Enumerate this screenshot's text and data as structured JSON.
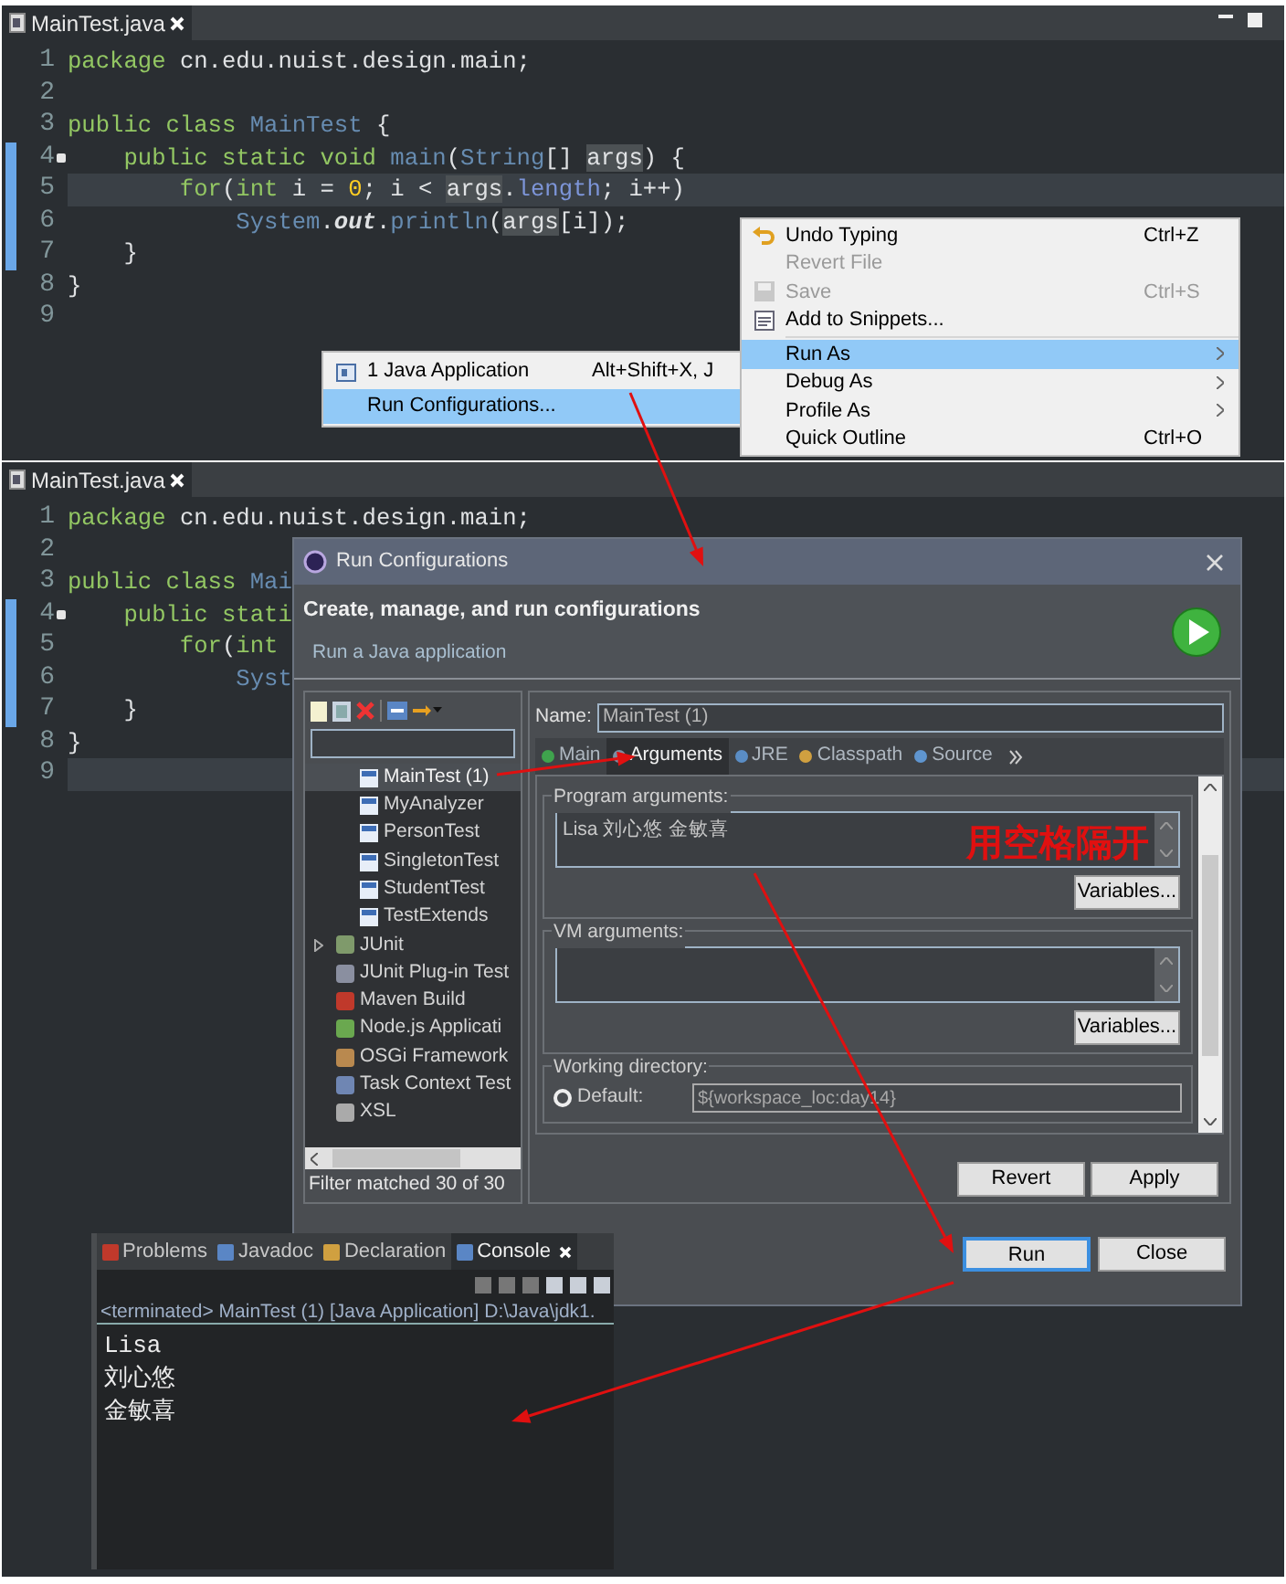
{
  "editors": [
    {
      "tab": {
        "label": "MainTest.java",
        "selected": true
      },
      "lines": [
        {
          "number": "1",
          "current": false,
          "changed": false,
          "override": false,
          "segments": [
            {
              "text": "package",
              "kind": "keyword"
            },
            {
              "text": " cn.edu.nuist.design.main;",
              "kind": "plain"
            }
          ]
        },
        {
          "number": "2",
          "current": false,
          "changed": false,
          "override": false
        },
        {
          "number": "3",
          "current": false,
          "changed": false,
          "override": false,
          "segments": [
            {
              "text": "public class ",
              "kind": "keyword"
            },
            {
              "text": "MainTest",
              "kind": "type"
            },
            {
              "text": " {",
              "kind": "plain"
            }
          ]
        },
        {
          "number": "4",
          "current": false,
          "changed": true,
          "override": true,
          "segments": [
            {
              "text": "    public static void ",
              "kind": "keyword"
            },
            {
              "text": "main",
              "kind": "method"
            },
            {
              "text": "(",
              "kind": "plain"
            },
            {
              "text": "String",
              "kind": "type"
            },
            {
              "text": "[] ",
              "kind": "plain"
            },
            {
              "text": "args",
              "kind": "occurrence"
            },
            {
              "text": ") {",
              "kind": "plain"
            }
          ]
        },
        {
          "number": "5",
          "current": true,
          "changed": true,
          "override": false,
          "segments": [
            {
              "text": "        for",
              "kind": "keyword"
            },
            {
              "text": "(",
              "kind": "plain"
            },
            {
              "text": "int",
              "kind": "keyword"
            },
            {
              "text": " i = ",
              "kind": "plain"
            },
            {
              "text": "0",
              "kind": "number"
            },
            {
              "text": "; i < ",
              "kind": "plain"
            },
            {
              "text": "args",
              "kind": "occurrence"
            },
            {
              "text": ".",
              "kind": "plain"
            },
            {
              "text": "length",
              "kind": "field"
            },
            {
              "text": "; i++)",
              "kind": "plain"
            }
          ]
        },
        {
          "number": "6",
          "current": false,
          "changed": true,
          "override": false,
          "segments": [
            {
              "text": "            System",
              "kind": "type"
            },
            {
              "text": ".",
              "kind": "plain"
            },
            {
              "text": "out",
              "kind": "static"
            },
            {
              "text": ".",
              "kind": "plain"
            },
            {
              "text": "println",
              "kind": "method"
            },
            {
              "text": "(",
              "kind": "plain"
            },
            {
              "text": "args",
              "kind": "occurrence"
            },
            {
              "text": "[i]);",
              "kind": "plain"
            }
          ]
        },
        {
          "number": "7",
          "current": false,
          "changed": true,
          "override": false,
          "segments": [
            {
              "text": "    }",
              "kind": "plain"
            }
          ]
        },
        {
          "number": "8",
          "current": false,
          "changed": false,
          "override": false,
          "segments": [
            {
              "text": "}",
              "kind": "plain"
            }
          ]
        },
        {
          "number": "9",
          "current": false,
          "changed": false,
          "override": false
        }
      ]
    },
    {
      "tab": {
        "label": "MainTest.java",
        "selected": true
      },
      "lines": [
        {
          "number": "1",
          "current": false,
          "changed": false,
          "override": false,
          "segments": [
            {
              "text": "package",
              "kind": "keyword"
            },
            {
              "text": " cn.edu.nuist.design.main;",
              "kind": "plain"
            }
          ]
        },
        {
          "number": "2",
          "current": false,
          "changed": false,
          "override": false
        },
        {
          "number": "3",
          "current": false,
          "changed": false,
          "override": false,
          "segments": [
            {
              "text": "public class ",
              "kind": "keyword"
            },
            {
              "text": "Mai",
              "kind": "type"
            }
          ]
        },
        {
          "number": "4",
          "current": false,
          "changed": true,
          "override": true,
          "segments": [
            {
              "text": "    public stati",
              "kind": "keyword"
            }
          ]
        },
        {
          "number": "5",
          "current": false,
          "changed": true,
          "override": false,
          "segments": [
            {
              "text": "        for",
              "kind": "keyword"
            },
            {
              "text": "(",
              "kind": "plain"
            },
            {
              "text": "int",
              "kind": "keyword"
            }
          ]
        },
        {
          "number": "6",
          "current": false,
          "changed": true,
          "override": false,
          "segments": [
            {
              "text": "            Syst",
              "kind": "type"
            }
          ]
        },
        {
          "number": "7",
          "current": false,
          "changed": true,
          "override": false,
          "segments": [
            {
              "text": "    }",
              "kind": "plain"
            }
          ]
        },
        {
          "number": "8",
          "current": false,
          "changed": false,
          "override": false,
          "segments": [
            {
              "text": "}",
              "kind": "plain"
            }
          ]
        },
        {
          "number": "9",
          "current": true,
          "changed": false,
          "override": false
        }
      ]
    }
  ],
  "context_menu": {
    "items": [
      {
        "kind": "item",
        "label": "Undo Typing",
        "shortcut": "Ctrl+Z",
        "disabled": false,
        "selected": false,
        "submenu": false
      },
      {
        "kind": "item",
        "label": "Revert File",
        "disabled": true,
        "selected": false,
        "submenu": false
      },
      {
        "kind": "item",
        "label": "Save",
        "shortcut": "Ctrl+S",
        "disabled": true,
        "selected": false,
        "submenu": false
      },
      {
        "kind": "item",
        "label": "Add to Snippets...",
        "disabled": false,
        "selected": false,
        "submenu": false
      },
      {
        "kind": "separator"
      },
      {
        "kind": "item",
        "label": "Run As",
        "disabled": false,
        "selected": true,
        "submenu": true
      },
      {
        "kind": "item",
        "label": "Debug As",
        "disabled": false,
        "selected": false,
        "submenu": true
      },
      {
        "kind": "item",
        "label": "Profile As",
        "disabled": false,
        "selected": false,
        "submenu": true
      },
      {
        "kind": "item",
        "label": "Quick Outline",
        "shortcut": "Ctrl+O",
        "disabled": false,
        "selected": false,
        "submenu": false
      }
    ]
  },
  "run_as_submenu": {
    "items": [
      {
        "label": "1 Java Application",
        "shortcut": "Alt+Shift+X, J",
        "selected": false
      },
      {
        "label": "Run Configurations...",
        "selected": true
      }
    ]
  },
  "dialog": {
    "title": "Run Configurations",
    "heading": "Create, manage, and run configurations",
    "subtitle": "Run a Java application",
    "tree": [
      {
        "label": "MainTest (1)",
        "kind": "config",
        "selected": true,
        "expandable": false
      },
      {
        "label": "MyAnalyzer",
        "kind": "config",
        "selected": false,
        "expandable": false
      },
      {
        "label": "PersonTest",
        "kind": "config",
        "selected": false,
        "expandable": false
      },
      {
        "label": "SingletonTest",
        "kind": "config",
        "selected": false,
        "expandable": false
      },
      {
        "label": "StudentTest",
        "kind": "config",
        "selected": false,
        "expandable": false
      },
      {
        "label": "TestExtends",
        "kind": "config",
        "selected": false,
        "expandable": false
      },
      {
        "label": "JUnit",
        "kind": "type",
        "selected": false,
        "expandable": true
      },
      {
        "label": "JUnit Plug-in Test",
        "kind": "type",
        "selected": false,
        "expandable": false
      },
      {
        "label": "Maven Build",
        "kind": "type",
        "selected": false,
        "expandable": false
      },
      {
        "label": "Node.js Applicati",
        "kind": "type",
        "selected": false,
        "expandable": false
      },
      {
        "label": "OSGi Framework",
        "kind": "type",
        "selected": false,
        "expandable": false
      },
      {
        "label": "Task Context Test",
        "kind": "type",
        "selected": false,
        "expandable": false
      },
      {
        "label": "XSL",
        "kind": "type",
        "selected": false,
        "expandable": false
      }
    ],
    "filter_status": "Filter matched 30 of 30",
    "name_label": "Name:",
    "name_value": "MainTest (1)",
    "tabs": [
      {
        "label": "Main",
        "selected": false
      },
      {
        "label": "Arguments",
        "selected": true
      },
      {
        "label": "JRE",
        "selected": false
      },
      {
        "label": "Classpath",
        "selected": false
      },
      {
        "label": "Source",
        "selected": false
      }
    ],
    "program_arguments": {
      "label": "Program arguments:",
      "value": "Lisa 刘心悠 金敏喜",
      "button": "Variables..."
    },
    "vm_arguments": {
      "label": "VM arguments:",
      "button": "Variables..."
    },
    "working_directory": {
      "label": "Working directory:",
      "option": {
        "label": "Default:",
        "selected": false
      },
      "value": "${workspace_loc:day14}"
    },
    "buttons": [
      {
        "label": "Revert",
        "focused": false
      },
      {
        "label": "Apply",
        "focused": false
      }
    ],
    "footer_buttons": [
      {
        "label": "Run",
        "focused": true
      },
      {
        "label": "Close",
        "focused": false
      }
    ]
  },
  "console": {
    "tabs": [
      {
        "label": "Problems",
        "selected": false
      },
      {
        "label": "Javadoc",
        "selected": false
      },
      {
        "label": "Declaration",
        "selected": false
      },
      {
        "label": "Console",
        "selected": true
      }
    ],
    "status": "<terminated> MainTest (1) [Java Application] D:\\Java\\jdk1.",
    "output": [
      "Lisa",
      "刘心悠",
      "金敏喜"
    ]
  },
  "annotation": {
    "note": "用空格隔开"
  }
}
